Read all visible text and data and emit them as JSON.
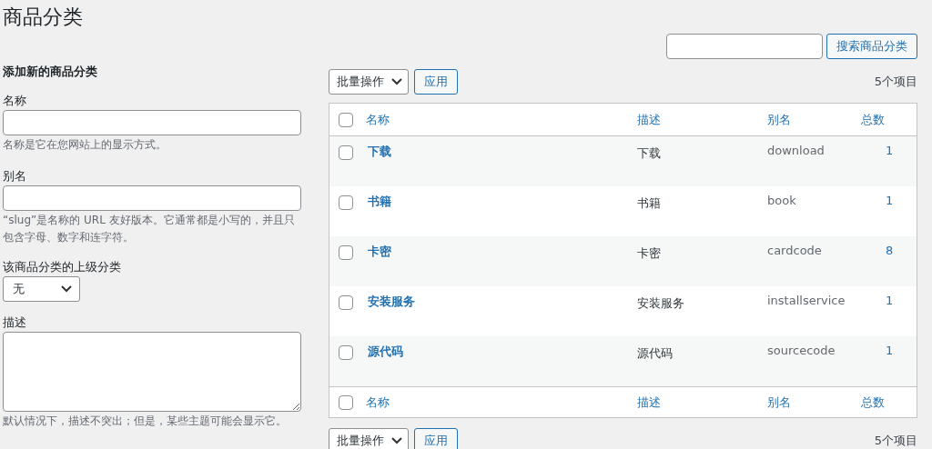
{
  "page_title": "商品分类",
  "search": {
    "button": "搜索商品分类"
  },
  "add_form": {
    "heading": "添加新的商品分类",
    "name": {
      "label": "名称",
      "hint": "名称是它在您网站上的显示方式。"
    },
    "slug": {
      "label": "别名",
      "hint": "“slug”是名称的 URL 友好版本。它通常都是小写的，并且只包含字母、数字和连字符。"
    },
    "parent": {
      "label": "该商品分类的上级分类",
      "value": "无"
    },
    "description": {
      "label": "描述",
      "hint": "默认情况下，描述不突出；但是，某些主题可能会显示它。"
    }
  },
  "top_actions": {
    "bulk": "批量操作",
    "apply": "应用",
    "count": "5个项目"
  },
  "table": {
    "columns": [
      "名称",
      "描述",
      "别名",
      "总数"
    ],
    "header_checked": false,
    "footer_checked": false,
    "footer_columns": [
      "名称",
      "描述",
      "别名",
      "总数"
    ],
    "rows": [
      {
        "name": "下载",
        "description": "下载",
        "slug": "download",
        "count": "1",
        "checked": false
      },
      {
        "name": "书籍",
        "description": "书籍",
        "slug": "book",
        "count": "1",
        "checked": false
      },
      {
        "name": "卡密",
        "description": "卡密",
        "slug": "cardcode",
        "count": "8",
        "checked": false
      },
      {
        "name": "安装服务",
        "description": "安装服务",
        "slug": "installservice",
        "count": "1",
        "checked": false
      },
      {
        "name": "源代码",
        "description": "源代码",
        "slug": "sourcecode",
        "count": "1",
        "checked": false
      }
    ]
  },
  "bottom_actions": {
    "bulk": "批量操作",
    "apply": "应用",
    "count": "5个项目"
  }
}
